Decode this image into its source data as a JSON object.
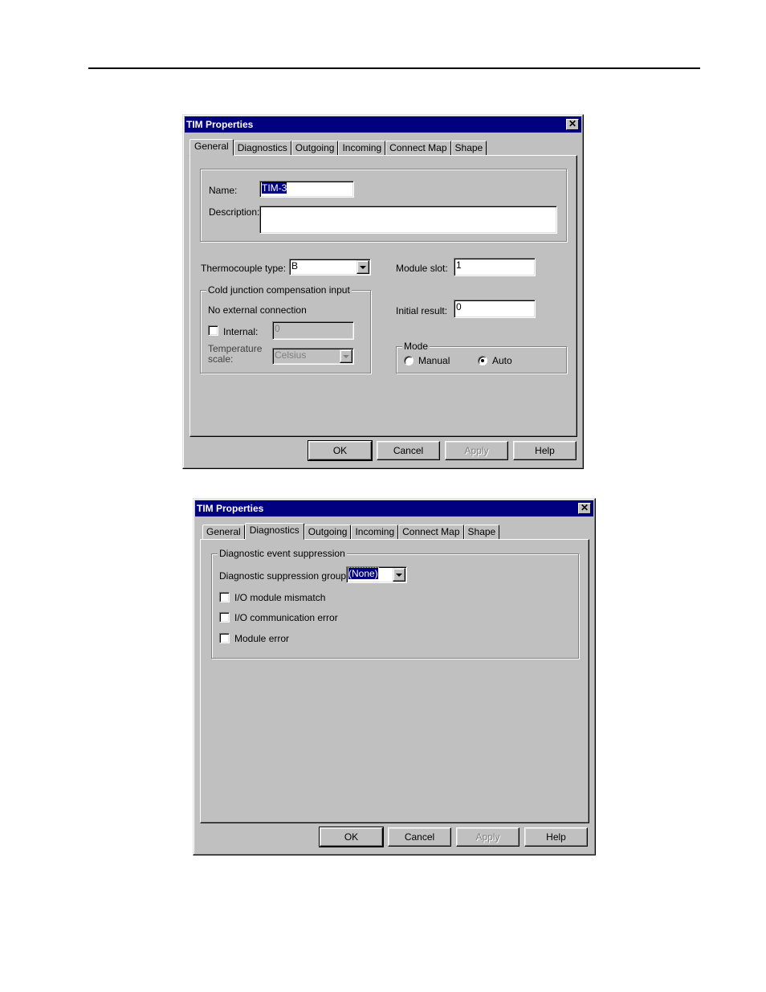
{
  "dialogs": [
    {
      "title": "TIM Properties",
      "active_tab": "General",
      "tabs": [
        "General",
        "Diagnostics",
        "Outgoing",
        "Incoming",
        "Connect Map",
        "Shape"
      ],
      "general": {
        "name_label": "Name:",
        "name_value": "TIM-3",
        "description_label": "Description:",
        "description_value": "",
        "thermocouple_label": "Thermocouple type:",
        "thermocouple_value": "B",
        "cjc_group_label": "Cold junction compensation input",
        "cjc_status": "No external connection",
        "internal_label": "Internal:",
        "internal_checked": false,
        "internal_value": "0",
        "temp_scale_label_1": "Temperature",
        "temp_scale_label_2": "scale:",
        "temp_scale_value": "Celsius",
        "module_slot_label": "Module slot:",
        "module_slot_value": "1",
        "initial_result_label": "Initial result:",
        "initial_result_value": "0",
        "mode_group_label": "Mode",
        "mode_options": [
          "Manual",
          "Auto"
        ],
        "mode_selected": "Auto"
      },
      "buttons": {
        "ok": "OK",
        "cancel": "Cancel",
        "apply": "Apply",
        "help": "Help"
      }
    },
    {
      "title": "TIM Properties",
      "active_tab": "Diagnostics",
      "tabs": [
        "General",
        "Diagnostics",
        "Outgoing",
        "Incoming",
        "Connect Map",
        "Shape"
      ],
      "diagnostics": {
        "group_label": "Diagnostic event suppression",
        "suppression_group_label": "Diagnostic suppression group:",
        "suppression_group_value": "(None)",
        "checkboxes": [
          {
            "label": "I/O module mismatch",
            "checked": false
          },
          {
            "label": "I/O communication error",
            "checked": false
          },
          {
            "label": "Module error",
            "checked": false
          }
        ]
      },
      "buttons": {
        "ok": "OK",
        "cancel": "Cancel",
        "apply": "Apply",
        "help": "Help"
      }
    }
  ],
  "icons": {
    "close": "close-icon",
    "dropdown": "chevron-down-icon"
  }
}
